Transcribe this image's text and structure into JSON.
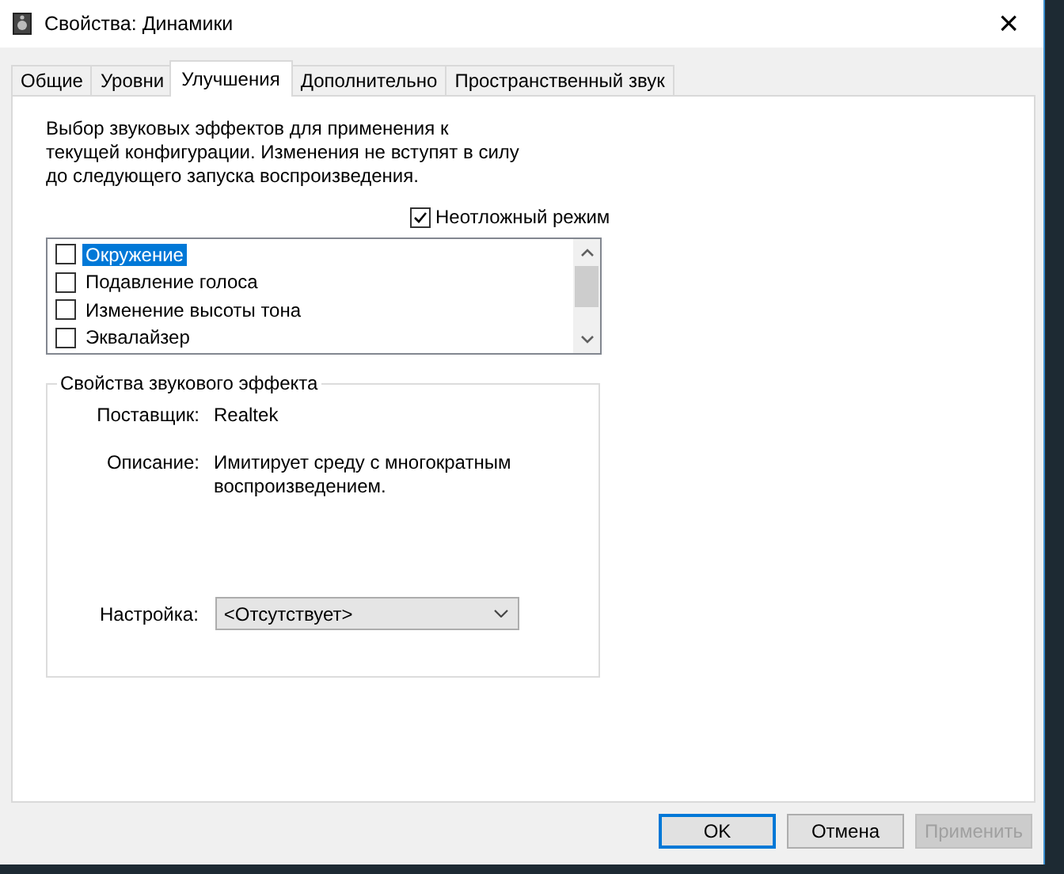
{
  "window": {
    "title": "Свойства: Динамики",
    "close": "×"
  },
  "tabs": [
    {
      "label": "Общие",
      "selected": false
    },
    {
      "label": "Уровни",
      "selected": false
    },
    {
      "label": "Улучшения",
      "selected": true
    },
    {
      "label": "Дополнительно",
      "selected": false
    },
    {
      "label": "Пространственный звук",
      "selected": false
    }
  ],
  "intro": "Выбор звуковых эффектов для применения к текущей конфигурации. Изменения не вступят в силу до следующего запуска воспроизведения.",
  "immediate_mode": {
    "label": "Неотложный режим",
    "checked": true
  },
  "effects": [
    {
      "label": "Окружение",
      "checked": false,
      "selected": true
    },
    {
      "label": "Подавление голоса",
      "checked": false,
      "selected": false
    },
    {
      "label": "Изменение высоты тона",
      "checked": false,
      "selected": false
    },
    {
      "label": "Эквалайзер",
      "checked": false,
      "selected": false
    }
  ],
  "effect_properties": {
    "title": "Свойства звукового эффекта",
    "fields": [
      {
        "label": "Поставщик:",
        "value": "Realtek"
      },
      {
        "label": "Описание:",
        "value": "Имитирует среду с многократным воспроизведением."
      }
    ],
    "setting": {
      "label": "Настройка:",
      "value": "<Отсутствует>"
    }
  },
  "buttons": [
    {
      "label": "OK",
      "kind": "default",
      "disabled": false
    },
    {
      "label": "Отмена",
      "kind": "normal",
      "disabled": false
    },
    {
      "label": "Применить",
      "kind": "normal",
      "disabled": true
    }
  ]
}
